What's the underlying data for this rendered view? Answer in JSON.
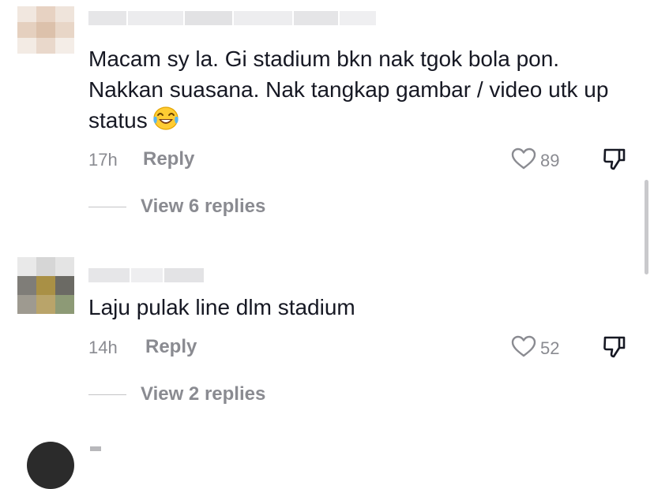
{
  "comments": [
    {
      "text": "Macam sy la. Gi stadium bkn nak tgok bola pon. Nakkan suasana. Nak tangkap gambar / video utk up status",
      "emoji": "face-with-tears-of-joy",
      "time": "17h",
      "reply_label": "Reply",
      "likes": "89",
      "view_replies": "View 6 replies"
    },
    {
      "text": "Laju pulak line dlm stadium",
      "time": "14h",
      "reply_label": "Reply",
      "likes": "52",
      "view_replies": "View 2 replies"
    }
  ],
  "icons": {
    "like": "heart-outline-icon",
    "dislike": "thumbs-down-icon"
  },
  "colors": {
    "text": "#161823",
    "secondary": "#8a8b91",
    "divider": "#c4c4c6"
  }
}
